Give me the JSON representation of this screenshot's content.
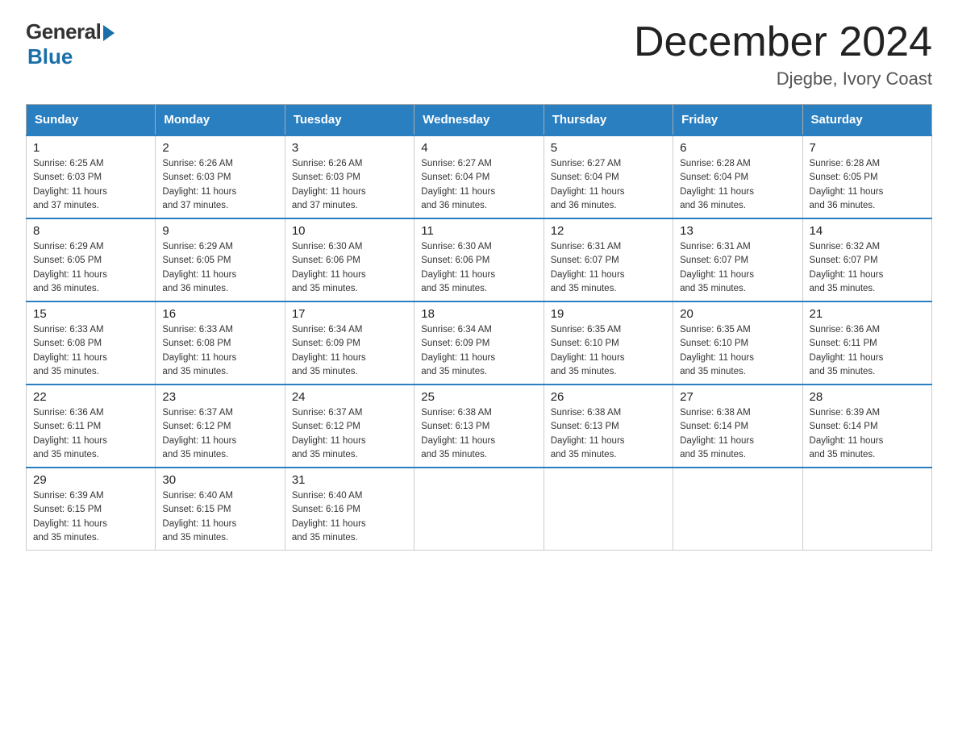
{
  "logo": {
    "general": "General",
    "blue": "Blue"
  },
  "title": "December 2024",
  "location": "Djegbe, Ivory Coast",
  "days_of_week": [
    "Sunday",
    "Monday",
    "Tuesday",
    "Wednesday",
    "Thursday",
    "Friday",
    "Saturday"
  ],
  "weeks": [
    [
      {
        "day": "1",
        "sunrise": "6:25 AM",
        "sunset": "6:03 PM",
        "daylight": "11 hours and 37 minutes."
      },
      {
        "day": "2",
        "sunrise": "6:26 AM",
        "sunset": "6:03 PM",
        "daylight": "11 hours and 37 minutes."
      },
      {
        "day": "3",
        "sunrise": "6:26 AM",
        "sunset": "6:03 PM",
        "daylight": "11 hours and 37 minutes."
      },
      {
        "day": "4",
        "sunrise": "6:27 AM",
        "sunset": "6:04 PM",
        "daylight": "11 hours and 36 minutes."
      },
      {
        "day": "5",
        "sunrise": "6:27 AM",
        "sunset": "6:04 PM",
        "daylight": "11 hours and 36 minutes."
      },
      {
        "day": "6",
        "sunrise": "6:28 AM",
        "sunset": "6:04 PM",
        "daylight": "11 hours and 36 minutes."
      },
      {
        "day": "7",
        "sunrise": "6:28 AM",
        "sunset": "6:05 PM",
        "daylight": "11 hours and 36 minutes."
      }
    ],
    [
      {
        "day": "8",
        "sunrise": "6:29 AM",
        "sunset": "6:05 PM",
        "daylight": "11 hours and 36 minutes."
      },
      {
        "day": "9",
        "sunrise": "6:29 AM",
        "sunset": "6:05 PM",
        "daylight": "11 hours and 36 minutes."
      },
      {
        "day": "10",
        "sunrise": "6:30 AM",
        "sunset": "6:06 PM",
        "daylight": "11 hours and 35 minutes."
      },
      {
        "day": "11",
        "sunrise": "6:30 AM",
        "sunset": "6:06 PM",
        "daylight": "11 hours and 35 minutes."
      },
      {
        "day": "12",
        "sunrise": "6:31 AM",
        "sunset": "6:07 PM",
        "daylight": "11 hours and 35 minutes."
      },
      {
        "day": "13",
        "sunrise": "6:31 AM",
        "sunset": "6:07 PM",
        "daylight": "11 hours and 35 minutes."
      },
      {
        "day": "14",
        "sunrise": "6:32 AM",
        "sunset": "6:07 PM",
        "daylight": "11 hours and 35 minutes."
      }
    ],
    [
      {
        "day": "15",
        "sunrise": "6:33 AM",
        "sunset": "6:08 PM",
        "daylight": "11 hours and 35 minutes."
      },
      {
        "day": "16",
        "sunrise": "6:33 AM",
        "sunset": "6:08 PM",
        "daylight": "11 hours and 35 minutes."
      },
      {
        "day": "17",
        "sunrise": "6:34 AM",
        "sunset": "6:09 PM",
        "daylight": "11 hours and 35 minutes."
      },
      {
        "day": "18",
        "sunrise": "6:34 AM",
        "sunset": "6:09 PM",
        "daylight": "11 hours and 35 minutes."
      },
      {
        "day": "19",
        "sunrise": "6:35 AM",
        "sunset": "6:10 PM",
        "daylight": "11 hours and 35 minutes."
      },
      {
        "day": "20",
        "sunrise": "6:35 AM",
        "sunset": "6:10 PM",
        "daylight": "11 hours and 35 minutes."
      },
      {
        "day": "21",
        "sunrise": "6:36 AM",
        "sunset": "6:11 PM",
        "daylight": "11 hours and 35 minutes."
      }
    ],
    [
      {
        "day": "22",
        "sunrise": "6:36 AM",
        "sunset": "6:11 PM",
        "daylight": "11 hours and 35 minutes."
      },
      {
        "day": "23",
        "sunrise": "6:37 AM",
        "sunset": "6:12 PM",
        "daylight": "11 hours and 35 minutes."
      },
      {
        "day": "24",
        "sunrise": "6:37 AM",
        "sunset": "6:12 PM",
        "daylight": "11 hours and 35 minutes."
      },
      {
        "day": "25",
        "sunrise": "6:38 AM",
        "sunset": "6:13 PM",
        "daylight": "11 hours and 35 minutes."
      },
      {
        "day": "26",
        "sunrise": "6:38 AM",
        "sunset": "6:13 PM",
        "daylight": "11 hours and 35 minutes."
      },
      {
        "day": "27",
        "sunrise": "6:38 AM",
        "sunset": "6:14 PM",
        "daylight": "11 hours and 35 minutes."
      },
      {
        "day": "28",
        "sunrise": "6:39 AM",
        "sunset": "6:14 PM",
        "daylight": "11 hours and 35 minutes."
      }
    ],
    [
      {
        "day": "29",
        "sunrise": "6:39 AM",
        "sunset": "6:15 PM",
        "daylight": "11 hours and 35 minutes."
      },
      {
        "day": "30",
        "sunrise": "6:40 AM",
        "sunset": "6:15 PM",
        "daylight": "11 hours and 35 minutes."
      },
      {
        "day": "31",
        "sunrise": "6:40 AM",
        "sunset": "6:16 PM",
        "daylight": "11 hours and 35 minutes."
      },
      null,
      null,
      null,
      null
    ]
  ],
  "labels": {
    "sunrise": "Sunrise:",
    "sunset": "Sunset:",
    "daylight": "Daylight:"
  }
}
